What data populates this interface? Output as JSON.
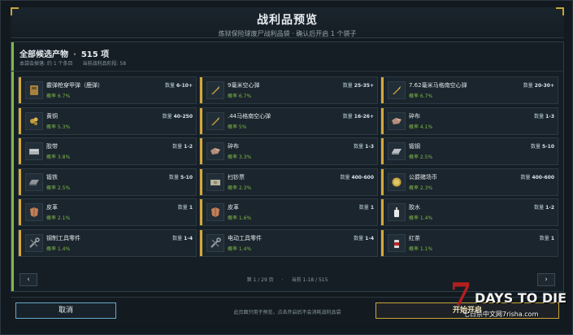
{
  "header": {
    "title": "战利品预览",
    "subtitle": "炼狱保险球废尸战利品袋 · 确认后开启 1 个袋子"
  },
  "section": {
    "title": "全部候选产物",
    "count": "515 项",
    "meta_a": "本袋会掉落: 约 1 个条目",
    "meta_b": "当前战利品阶段: 58"
  },
  "items": [
    {
      "name": "霰弹枪穿甲弹（鹿弹）",
      "qty_label": "数量",
      "qty": "6-10+",
      "prob": "概率 6.7%",
      "icon": "ammo-box-icon"
    },
    {
      "name": "9毫米空心弹",
      "qty_label": "数量",
      "qty": "25-35+",
      "prob": "概率 6.7%",
      "icon": "bullet-icon"
    },
    {
      "name": "7.62毫米马格南空心弹",
      "qty_label": "数量",
      "qty": "20-30+",
      "prob": "概率 6.7%",
      "icon": "bullet-icon"
    },
    {
      "name": "黄铜",
      "qty_label": "数量",
      "qty": "40-250",
      "prob": "概率 5.3%",
      "icon": "brass-scrap-icon"
    },
    {
      "name": ".44马格南空心弹",
      "qty_label": "数量",
      "qty": "16-26+",
      "prob": "概率 5%",
      "icon": "bullet-icon"
    },
    {
      "name": "碎布",
      "qty_label": "数量",
      "qty": "1-3",
      "prob": "概率 4.1%",
      "icon": "cloth-icon"
    },
    {
      "name": "胶带",
      "qty_label": "数量",
      "qty": "1-2",
      "prob": "概率 3.8%",
      "icon": "tape-icon"
    },
    {
      "name": "碎布",
      "qty_label": "数量",
      "qty": "1-3",
      "prob": "概率 3.3%",
      "icon": "cloth-icon"
    },
    {
      "name": "锻钢",
      "qty_label": "数量",
      "qty": "5-10",
      "prob": "概率 2.5%",
      "icon": "steel-ingot-icon"
    },
    {
      "name": "锻铁",
      "qty_label": "数量",
      "qty": "5-10",
      "prob": "概率 2.5%",
      "icon": "iron-ingot-icon"
    },
    {
      "name": "扫钞票",
      "qty_label": "数量",
      "qty": "400-600",
      "prob": "概率 2.3%",
      "icon": "cash-icon"
    },
    {
      "name": "公爵赌场币",
      "qty_label": "数量",
      "qty": "400-600",
      "prob": "概率 2.3%",
      "icon": "coin-icon"
    },
    {
      "name": "皮革",
      "qty_label": "数量",
      "qty": "1",
      "prob": "概率 2.1%",
      "icon": "leather-icon"
    },
    {
      "name": "皮革",
      "qty_label": "数量",
      "qty": "1",
      "prob": "概率 1.6%",
      "icon": "leather-icon"
    },
    {
      "name": "胶水",
      "qty_label": "数量",
      "qty": "1-2",
      "prob": "概率 1.4%",
      "icon": "glue-icon"
    },
    {
      "name": "钢制工具零件",
      "qty_label": "数量",
      "qty": "1-4",
      "prob": "概率 1.4%",
      "icon": "tool-parts-icon"
    },
    {
      "name": "电动工具零件",
      "qty_label": "数量",
      "qty": "1-4",
      "prob": "概率 1.4%",
      "icon": "tool-parts-icon"
    },
    {
      "name": "红茶",
      "qty_label": "数量",
      "qty": "1",
      "prob": "概率 1.1%",
      "icon": "tea-icon"
    }
  ],
  "pager": {
    "prev": "‹",
    "next": "›",
    "page": "第 1 / 29 页",
    "sep": "·",
    "range": "当前 1-18 / 515"
  },
  "footer": {
    "cancel": "取消",
    "note": "此页面只用于预览，点击开启后不会消耗战利品袋",
    "open": "开始开启"
  },
  "watermark": {
    "seven": "7",
    "title": "DAYS TO DIE",
    "site": "七日杀中文网7risha.com"
  },
  "colors": {
    "accent_green": "#7fb84a",
    "accent_gold": "#c9a43a",
    "accent_blue": "#6aa8c8",
    "brand_red": "#b21f1f"
  }
}
